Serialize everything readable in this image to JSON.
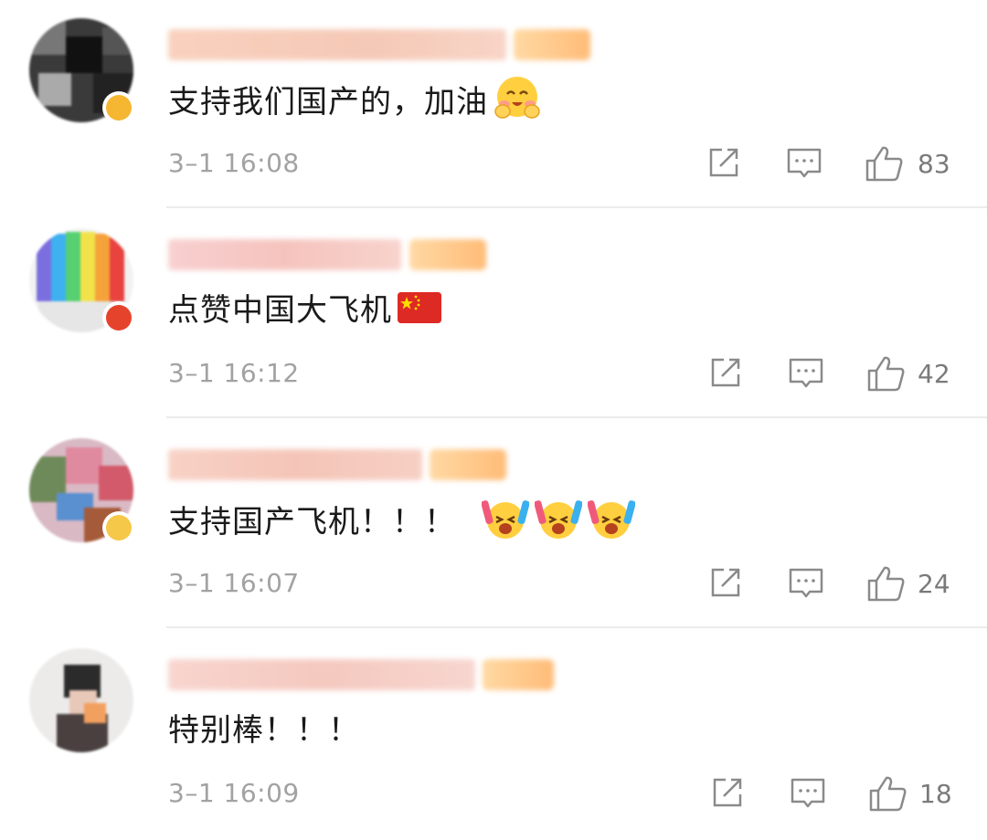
{
  "comments": [
    {
      "text": "支持我们国产的，加油",
      "emojis": [
        "blush-hands-emoji"
      ],
      "time": "3–1 16:08",
      "likes": "83"
    },
    {
      "text": "点赞中国大飞机",
      "emojis": [
        "china-flag-emoji"
      ],
      "time": "3–1 16:12",
      "likes": "42"
    },
    {
      "text": "支持国产飞机！！！",
      "emojis": [
        "cheering-emoji",
        "cheering-emoji",
        "cheering-emoji"
      ],
      "time": "3–1 16:07",
      "likes": "24"
    },
    {
      "text": "特别棒！！！",
      "emojis": [],
      "time": "3–1 16:09",
      "likes": "18"
    }
  ],
  "icons": {
    "share": "share-icon",
    "comment": "comment-icon",
    "like": "thumbs-up-icon"
  },
  "colors": {
    "text": "#1a1a1a",
    "meta": "#a2a2a2",
    "icon": "#8a8a8a",
    "divider": "#ececec"
  }
}
